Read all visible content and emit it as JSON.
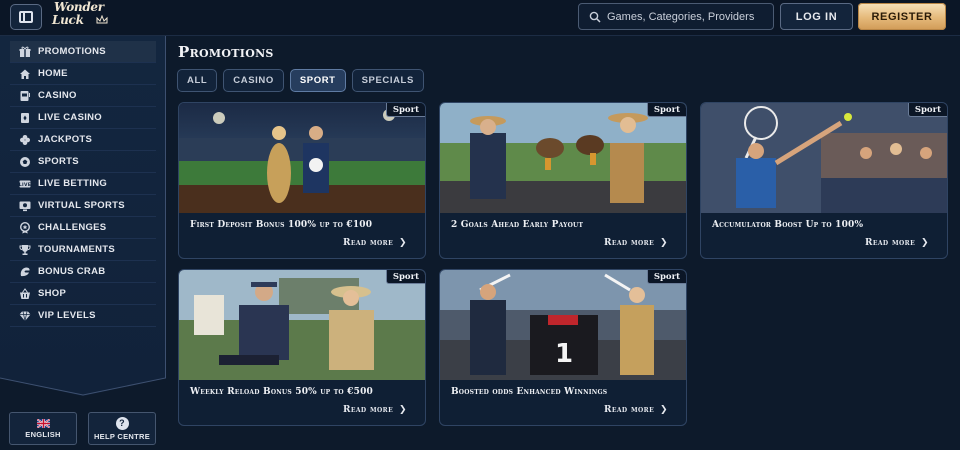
{
  "header": {
    "logo_line1": "Wonder",
    "logo_line2": "Luck",
    "search_placeholder": "Games, Categories, Providers",
    "login_label": "LOG IN",
    "register_label": "REGISTER"
  },
  "sidebar": {
    "items": [
      {
        "label": "PROMOTIONS",
        "icon": "gift-icon"
      },
      {
        "label": "HOME",
        "icon": "home-icon"
      },
      {
        "label": "CASINO",
        "icon": "slot-machine-icon"
      },
      {
        "label": "LIVE CASINO",
        "icon": "live-cards-icon"
      },
      {
        "label": "JACKPOTS",
        "icon": "clover-icon"
      },
      {
        "label": "SPORTS",
        "icon": "ball-icon"
      },
      {
        "label": "LIVE BETTING",
        "icon": "live-badge-icon"
      },
      {
        "label": "VIRTUAL SPORTS",
        "icon": "monitor-icon"
      },
      {
        "label": "CHALLENGES",
        "icon": "trophy-icon"
      },
      {
        "label": "TOURNAMENTS",
        "icon": "cup-icon"
      },
      {
        "label": "BONUS CRAB",
        "icon": "crab-claw-icon"
      },
      {
        "label": "SHOP",
        "icon": "basket-icon"
      },
      {
        "label": "VIP LEVELS",
        "icon": "diamond-icon"
      }
    ],
    "language_label": "ENGLISH",
    "help_label": "HELP CENTRE"
  },
  "main": {
    "title": "Promotions",
    "tabs": [
      {
        "label": "ALL",
        "active": false
      },
      {
        "label": "CASINO",
        "active": false
      },
      {
        "label": "SPORT",
        "active": true
      },
      {
        "label": "SPECIALS",
        "active": false
      }
    ],
    "cards": [
      {
        "badge": "Sport",
        "title": "First Deposit Bonus 100% up to €100",
        "cta": "Read more"
      },
      {
        "badge": "Sport",
        "title": "2 Goals Ahead Early Payout",
        "cta": "Read more"
      },
      {
        "badge": "Sport",
        "title": "Accumulator Boost Up to 100%",
        "cta": "Read more"
      },
      {
        "badge": "Sport",
        "title": "Weekly Reload Bonus 50% up to €500",
        "cta": "Read more"
      },
      {
        "badge": "Sport",
        "title": "Boosted odds Enhanced Winnings",
        "cta": "Read more"
      }
    ]
  },
  "colors": {
    "background": "#0d1a2b",
    "accent_gold": "#e5b97a",
    "active_tab": "#263d5e"
  }
}
